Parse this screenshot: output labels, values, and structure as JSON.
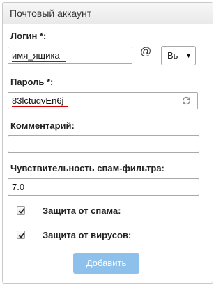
{
  "panel": {
    "title": "Почтовый аккаунт"
  },
  "login": {
    "label": "Логин *:",
    "value": "имя_ящика",
    "at": "@",
    "domain_value": "Вь"
  },
  "password": {
    "label": "Пароль *:",
    "value": "83lctuqvEn6j",
    "refresh_icon": "refresh-icon"
  },
  "comment": {
    "label": "Комментарий:",
    "value": ""
  },
  "spam_sensitivity": {
    "label": "Чувствительность спам-фильтра:",
    "value": "7.0"
  },
  "spam_protection": {
    "label": "Защита от спама:",
    "checked": true
  },
  "virus_protection": {
    "label": "Защита от вирусов:",
    "checked": true
  },
  "submit": {
    "label": "Добавить"
  },
  "colors": {
    "accent_button": "#8dc0ea",
    "underline": "#d90000"
  }
}
